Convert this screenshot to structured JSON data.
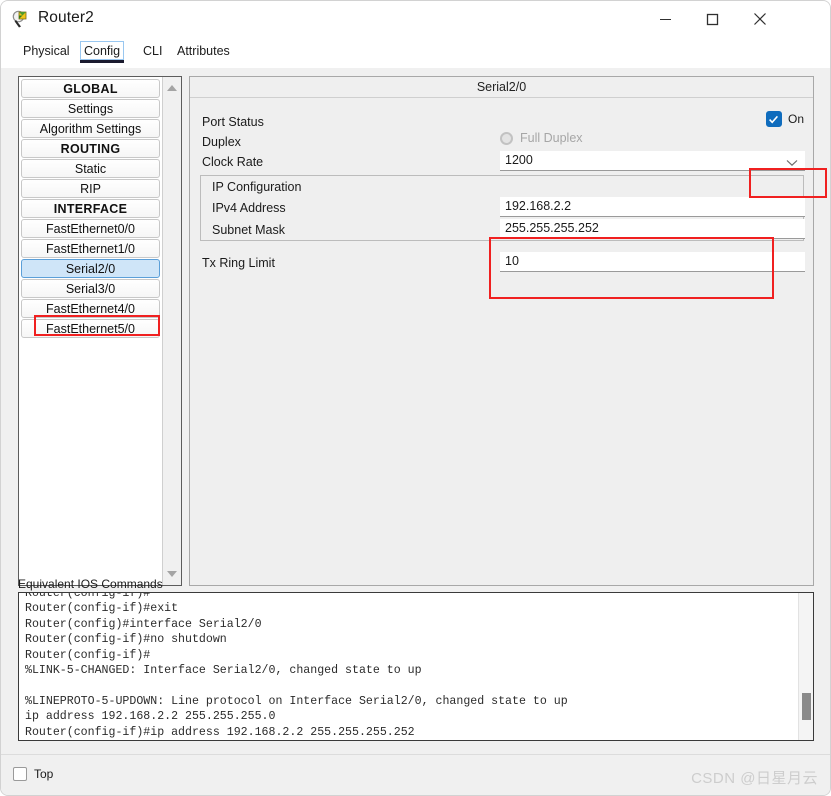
{
  "window": {
    "title": "Router2",
    "icon": "packet-tracer-device-icon",
    "minimize_label": "—",
    "maximize_label": "□",
    "close_label": "✕"
  },
  "tabs": [
    {
      "label": "Physical",
      "selected": false
    },
    {
      "label": "Config",
      "selected": true
    },
    {
      "label": "CLI",
      "selected": false
    },
    {
      "label": "Attributes",
      "selected": false
    }
  ],
  "sidebar": {
    "items": [
      {
        "label": "GLOBAL",
        "type": "header"
      },
      {
        "label": "Settings",
        "type": "item"
      },
      {
        "label": "Algorithm Settings",
        "type": "item"
      },
      {
        "label": "ROUTING",
        "type": "header"
      },
      {
        "label": "Static",
        "type": "item"
      },
      {
        "label": "RIP",
        "type": "item"
      },
      {
        "label": "INTERFACE",
        "type": "header"
      },
      {
        "label": "FastEthernet0/0",
        "type": "item"
      },
      {
        "label": "FastEthernet1/0",
        "type": "item"
      },
      {
        "label": "Serial2/0",
        "type": "item",
        "selected": true
      },
      {
        "label": "Serial3/0",
        "type": "item"
      },
      {
        "label": "FastEthernet4/0",
        "type": "item"
      },
      {
        "label": "FastEthernet5/0",
        "type": "item"
      }
    ]
  },
  "config_panel": {
    "header": "Serial2/0",
    "port_status": {
      "label": "Port Status",
      "checkbox_label": "On",
      "checked": true
    },
    "duplex": {
      "label": "Duplex",
      "option_label": "Full Duplex",
      "disabled": true,
      "selected": false
    },
    "clock_rate": {
      "label": "Clock Rate",
      "value": "1200"
    },
    "ip_configuration": {
      "group_label": "IP Configuration",
      "ipv4": {
        "label": "IPv4 Address",
        "value": "192.168.2.2"
      },
      "subnet": {
        "label": "Subnet Mask",
        "value": "255.255.255.252"
      }
    },
    "tx_ring_limit": {
      "label": "Tx Ring Limit",
      "value": "10"
    }
  },
  "ios": {
    "label": "Equivalent IOS Commands",
    "text": "Router(config-if)#\nRouter(config-if)#exit\nRouter(config)#interface Serial2/0\nRouter(config-if)#no shutdown\nRouter(config-if)#\n%LINK-5-CHANGED: Interface Serial2/0, changed state to up\n\n%LINEPROTO-5-UPDOWN: Line protocol on Interface Serial2/0, changed state to up\nip address 192.168.2.2 255.255.255.0\nRouter(config-if)#ip address 192.168.2.2 255.255.255.252\nRouter(config-if)#"
  },
  "bottom": {
    "top_checkbox_label": "Top",
    "top_checked": false,
    "watermark": "CSDN @日星月云"
  },
  "colors": {
    "accent_blue": "#0f6cbd",
    "annotation_red": "#f02020",
    "selection_blue": "#cfe5f8",
    "panel_bg": "#efefef"
  }
}
